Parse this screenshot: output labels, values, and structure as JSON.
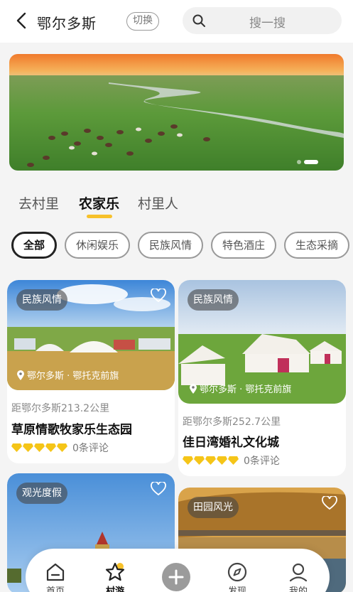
{
  "header": {
    "city": "鄂尔多斯",
    "switch_label": "切换",
    "search_placeholder": "搜一搜",
    "icons": [
      "back-arrow-icon",
      "search-icon"
    ]
  },
  "banner": {
    "slide_count": 2,
    "active_slide": 2,
    "alt": "grassland banner"
  },
  "tabs": [
    {
      "label": "去村里",
      "active": false
    },
    {
      "label": "农家乐",
      "active": true
    },
    {
      "label": "村里人",
      "active": false
    }
  ],
  "chips": [
    {
      "label": "全部",
      "active": true
    },
    {
      "label": "休闲娱乐",
      "active": false
    },
    {
      "label": "民族风情",
      "active": false
    },
    {
      "label": "特色酒庄",
      "active": false
    },
    {
      "label": "生态采摘",
      "active": false
    }
  ],
  "cards": [
    {
      "tag": "民族风情",
      "location": "鄂尔多斯 · 鄂托克前旗",
      "distance": "距鄂尔多斯213.2公里",
      "title": "草原情歌牧家乐生态园",
      "rating": 5,
      "comments": "0条评论"
    },
    {
      "tag": "民族风情",
      "location": "鄂尔多斯 · 鄂托克前旗",
      "distance": "距鄂尔多斯252.7公里",
      "title": "佳日湾婚礼文化城",
      "rating": 5,
      "comments": "0条评论"
    },
    {
      "tag": "观光度假"
    },
    {
      "tag": "田园风光"
    }
  ],
  "bottom_nav": [
    {
      "label": "首页",
      "icon": "home-icon",
      "active": false
    },
    {
      "label": "村游",
      "icon": "star-icon",
      "active": true
    },
    {
      "label": "",
      "icon": "plus-icon",
      "active": false
    },
    {
      "label": "发现",
      "icon": "compass-icon",
      "active": false
    },
    {
      "label": "我的",
      "icon": "user-icon",
      "active": false
    }
  ],
  "colors": {
    "accent": "#f7c12b",
    "background": "#f4f4f4",
    "tag_bg": "rgba(70,70,70,0.6)",
    "gem": "#f5c518"
  }
}
